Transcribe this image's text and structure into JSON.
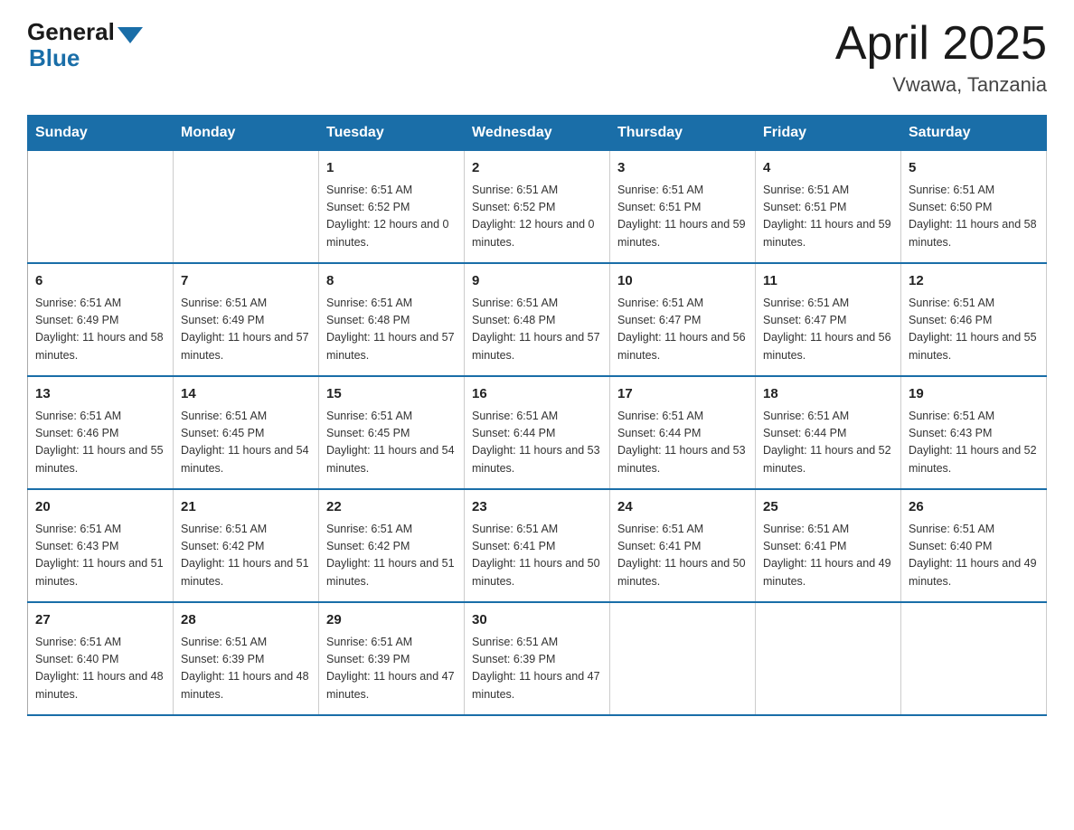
{
  "header": {
    "logo_general": "General",
    "logo_blue": "Blue",
    "title": "April 2025",
    "subtitle": "Vwawa, Tanzania"
  },
  "calendar": {
    "days_of_week": [
      "Sunday",
      "Monday",
      "Tuesday",
      "Wednesday",
      "Thursday",
      "Friday",
      "Saturday"
    ],
    "weeks": [
      [
        {
          "day": "",
          "info": ""
        },
        {
          "day": "",
          "info": ""
        },
        {
          "day": "1",
          "info": "Sunrise: 6:51 AM\nSunset: 6:52 PM\nDaylight: 12 hours and 0 minutes."
        },
        {
          "day": "2",
          "info": "Sunrise: 6:51 AM\nSunset: 6:52 PM\nDaylight: 12 hours and 0 minutes."
        },
        {
          "day": "3",
          "info": "Sunrise: 6:51 AM\nSunset: 6:51 PM\nDaylight: 11 hours and 59 minutes."
        },
        {
          "day": "4",
          "info": "Sunrise: 6:51 AM\nSunset: 6:51 PM\nDaylight: 11 hours and 59 minutes."
        },
        {
          "day": "5",
          "info": "Sunrise: 6:51 AM\nSunset: 6:50 PM\nDaylight: 11 hours and 58 minutes."
        }
      ],
      [
        {
          "day": "6",
          "info": "Sunrise: 6:51 AM\nSunset: 6:49 PM\nDaylight: 11 hours and 58 minutes."
        },
        {
          "day": "7",
          "info": "Sunrise: 6:51 AM\nSunset: 6:49 PM\nDaylight: 11 hours and 57 minutes."
        },
        {
          "day": "8",
          "info": "Sunrise: 6:51 AM\nSunset: 6:48 PM\nDaylight: 11 hours and 57 minutes."
        },
        {
          "day": "9",
          "info": "Sunrise: 6:51 AM\nSunset: 6:48 PM\nDaylight: 11 hours and 57 minutes."
        },
        {
          "day": "10",
          "info": "Sunrise: 6:51 AM\nSunset: 6:47 PM\nDaylight: 11 hours and 56 minutes."
        },
        {
          "day": "11",
          "info": "Sunrise: 6:51 AM\nSunset: 6:47 PM\nDaylight: 11 hours and 56 minutes."
        },
        {
          "day": "12",
          "info": "Sunrise: 6:51 AM\nSunset: 6:46 PM\nDaylight: 11 hours and 55 minutes."
        }
      ],
      [
        {
          "day": "13",
          "info": "Sunrise: 6:51 AM\nSunset: 6:46 PM\nDaylight: 11 hours and 55 minutes."
        },
        {
          "day": "14",
          "info": "Sunrise: 6:51 AM\nSunset: 6:45 PM\nDaylight: 11 hours and 54 minutes."
        },
        {
          "day": "15",
          "info": "Sunrise: 6:51 AM\nSunset: 6:45 PM\nDaylight: 11 hours and 54 minutes."
        },
        {
          "day": "16",
          "info": "Sunrise: 6:51 AM\nSunset: 6:44 PM\nDaylight: 11 hours and 53 minutes."
        },
        {
          "day": "17",
          "info": "Sunrise: 6:51 AM\nSunset: 6:44 PM\nDaylight: 11 hours and 53 minutes."
        },
        {
          "day": "18",
          "info": "Sunrise: 6:51 AM\nSunset: 6:44 PM\nDaylight: 11 hours and 52 minutes."
        },
        {
          "day": "19",
          "info": "Sunrise: 6:51 AM\nSunset: 6:43 PM\nDaylight: 11 hours and 52 minutes."
        }
      ],
      [
        {
          "day": "20",
          "info": "Sunrise: 6:51 AM\nSunset: 6:43 PM\nDaylight: 11 hours and 51 minutes."
        },
        {
          "day": "21",
          "info": "Sunrise: 6:51 AM\nSunset: 6:42 PM\nDaylight: 11 hours and 51 minutes."
        },
        {
          "day": "22",
          "info": "Sunrise: 6:51 AM\nSunset: 6:42 PM\nDaylight: 11 hours and 51 minutes."
        },
        {
          "day": "23",
          "info": "Sunrise: 6:51 AM\nSunset: 6:41 PM\nDaylight: 11 hours and 50 minutes."
        },
        {
          "day": "24",
          "info": "Sunrise: 6:51 AM\nSunset: 6:41 PM\nDaylight: 11 hours and 50 minutes."
        },
        {
          "day": "25",
          "info": "Sunrise: 6:51 AM\nSunset: 6:41 PM\nDaylight: 11 hours and 49 minutes."
        },
        {
          "day": "26",
          "info": "Sunrise: 6:51 AM\nSunset: 6:40 PM\nDaylight: 11 hours and 49 minutes."
        }
      ],
      [
        {
          "day": "27",
          "info": "Sunrise: 6:51 AM\nSunset: 6:40 PM\nDaylight: 11 hours and 48 minutes."
        },
        {
          "day": "28",
          "info": "Sunrise: 6:51 AM\nSunset: 6:39 PM\nDaylight: 11 hours and 48 minutes."
        },
        {
          "day": "29",
          "info": "Sunrise: 6:51 AM\nSunset: 6:39 PM\nDaylight: 11 hours and 47 minutes."
        },
        {
          "day": "30",
          "info": "Sunrise: 6:51 AM\nSunset: 6:39 PM\nDaylight: 11 hours and 47 minutes."
        },
        {
          "day": "",
          "info": ""
        },
        {
          "day": "",
          "info": ""
        },
        {
          "day": "",
          "info": ""
        }
      ]
    ]
  }
}
